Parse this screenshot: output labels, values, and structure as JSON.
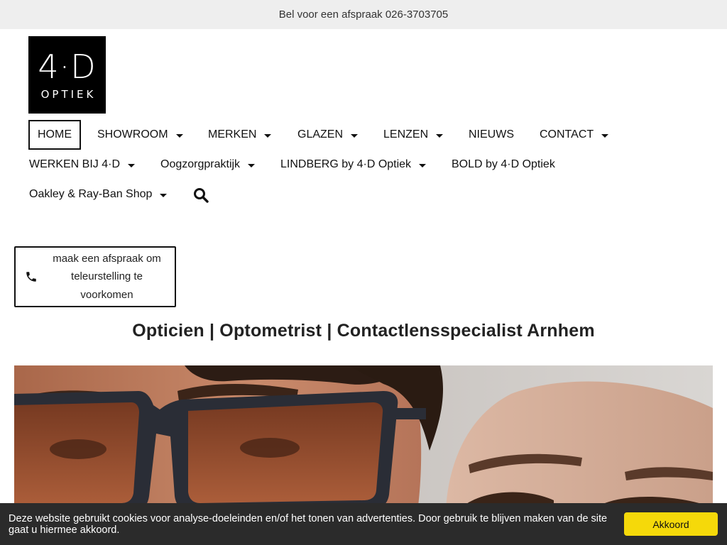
{
  "topbar": {
    "text": "Bel voor een afspraak 026-3703705"
  },
  "logo": {
    "big": "4·D",
    "small": "OPTIEK"
  },
  "nav": {
    "home": "HOME",
    "showroom": "SHOWROOM",
    "merken": "MERKEN",
    "glazen": "GLAZEN",
    "lenzen": "LENZEN",
    "nieuws": "NIEUWS",
    "contact": "CONTACT",
    "werken": "WERKEN BIJ 4·D",
    "oogzorg": "Oogzorgpraktijk",
    "lindberg": "LINDBERG by 4·D Optiek",
    "bold": "BOLD by 4·D Optiek",
    "oakley": "Oakley & Ray-Ban Shop"
  },
  "appointment": {
    "text": "maak een afspraak om teleurstelling te voorkomen"
  },
  "headline": "Opticien | Optometrist | Contactlensspecialist Arnhem",
  "cookie": {
    "message": "Deze website gebruikt cookies voor analyse-doeleinden en/of het tonen van advertenties. Door gebruik te blijven maken van de site gaat u hiermee akkoord.",
    "button": "Akkoord"
  },
  "colors": {
    "cookie_button": "#f5d90a",
    "topbar_bg": "#eeeeee",
    "cookie_bg": "#2b2b2b"
  },
  "icons": {
    "search": "search-icon",
    "phone": "phone-icon",
    "caret": "caret-down-icon"
  }
}
